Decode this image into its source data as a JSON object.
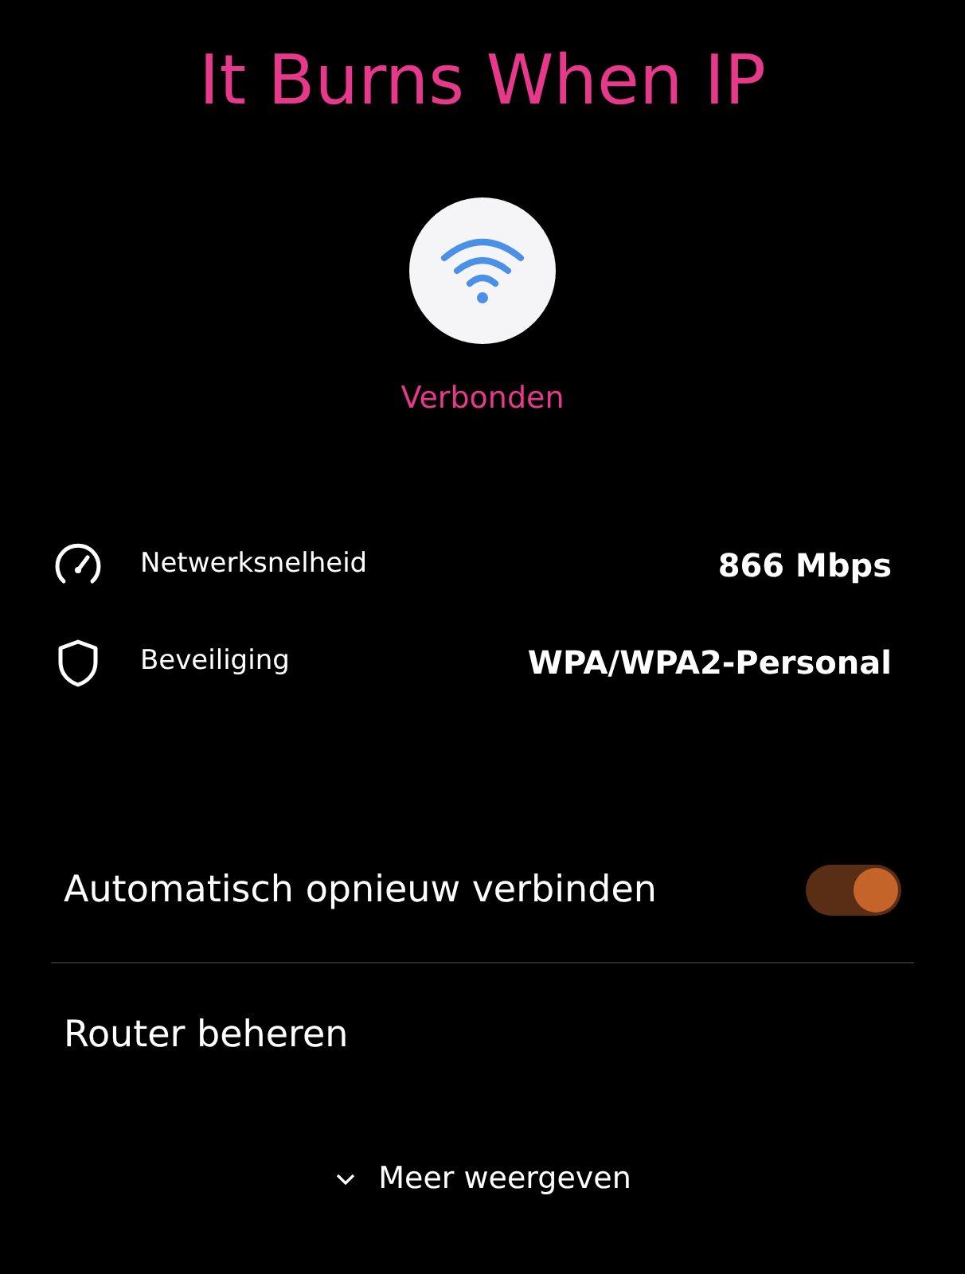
{
  "network": {
    "name": "It Burns When IP",
    "status": "Verbonden"
  },
  "details": [
    {
      "kind": "speed",
      "label": "Netwerksnelheid",
      "value": "866 Mbps"
    },
    {
      "kind": "security",
      "label": "Beveiliging",
      "value": "WPA/WPA2-Personal"
    }
  ],
  "settings": [
    {
      "kind": "toggle",
      "label": "Automatisch opnieuw verbinden",
      "on": true
    },
    {
      "kind": "link",
      "label": "Router beheren"
    }
  ],
  "more": {
    "label": "Meer weergeven",
    "expanded": false
  }
}
